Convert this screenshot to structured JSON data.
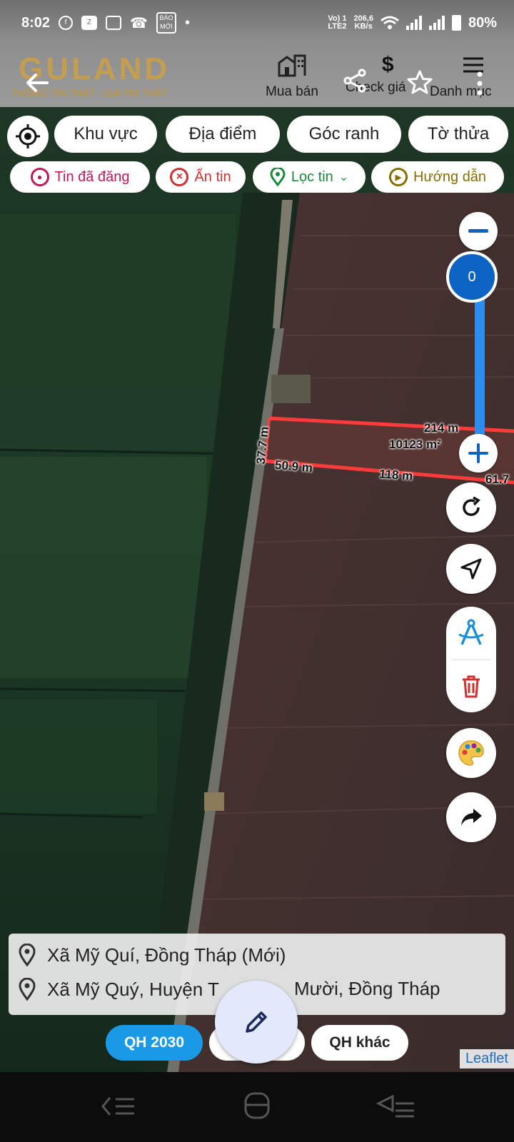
{
  "status_bar": {
    "time": "8:02",
    "network_top": "Vo) 1",
    "network_bottom": "LTE2",
    "speed_top": "206,6",
    "speed_bottom": "KB/s",
    "battery": "80%"
  },
  "header": {
    "logo_word": "GULAND",
    "tagline": "THÔNG TIN THẬT - GIÁ TRỊ THẬT",
    "nav": [
      {
        "label": "Mua bán",
        "icon": "building-icon"
      },
      {
        "label": "Check giá",
        "icon": "dollar-icon"
      },
      {
        "label": "Danh mục",
        "icon": "menu-icon"
      }
    ]
  },
  "filters": {
    "main": [
      "Khu vực",
      "Địa điểm",
      "Góc ranh",
      "Tờ thửa"
    ],
    "secondary": [
      {
        "label": "Tin đã đăng",
        "color": "#c2185b"
      },
      {
        "label": "Ẩn tin",
        "color": "#d32f2f"
      },
      {
        "label": "Lọc tin",
        "color": "#1b8a3a"
      },
      {
        "label": "Hướng dẫn",
        "color": "#8a6d00"
      }
    ]
  },
  "map": {
    "zoom_value": "0",
    "measurements": {
      "top_edge": "214 m",
      "area": "10123 m²",
      "left_edge": "37.7 m",
      "bottom_left": "50.9 m",
      "bottom_mid": "118 m",
      "bottom_right": "61.7"
    },
    "attribution": "Leaflet"
  },
  "address": {
    "new": "Xã Mỹ Quí, Đồng Tháp (Mới)",
    "old_left": "Xã Mỹ Quý, Huyện T",
    "old_right": "Mười, Đồng Tháp"
  },
  "planning": {
    "qh2030": "QH 2030",
    "other": "QH khác"
  },
  "colors": {
    "parcel_outline": "#ff3b3b",
    "accent_blue": "#0c63c4",
    "qh2030_bg": "#1a9ae6"
  }
}
